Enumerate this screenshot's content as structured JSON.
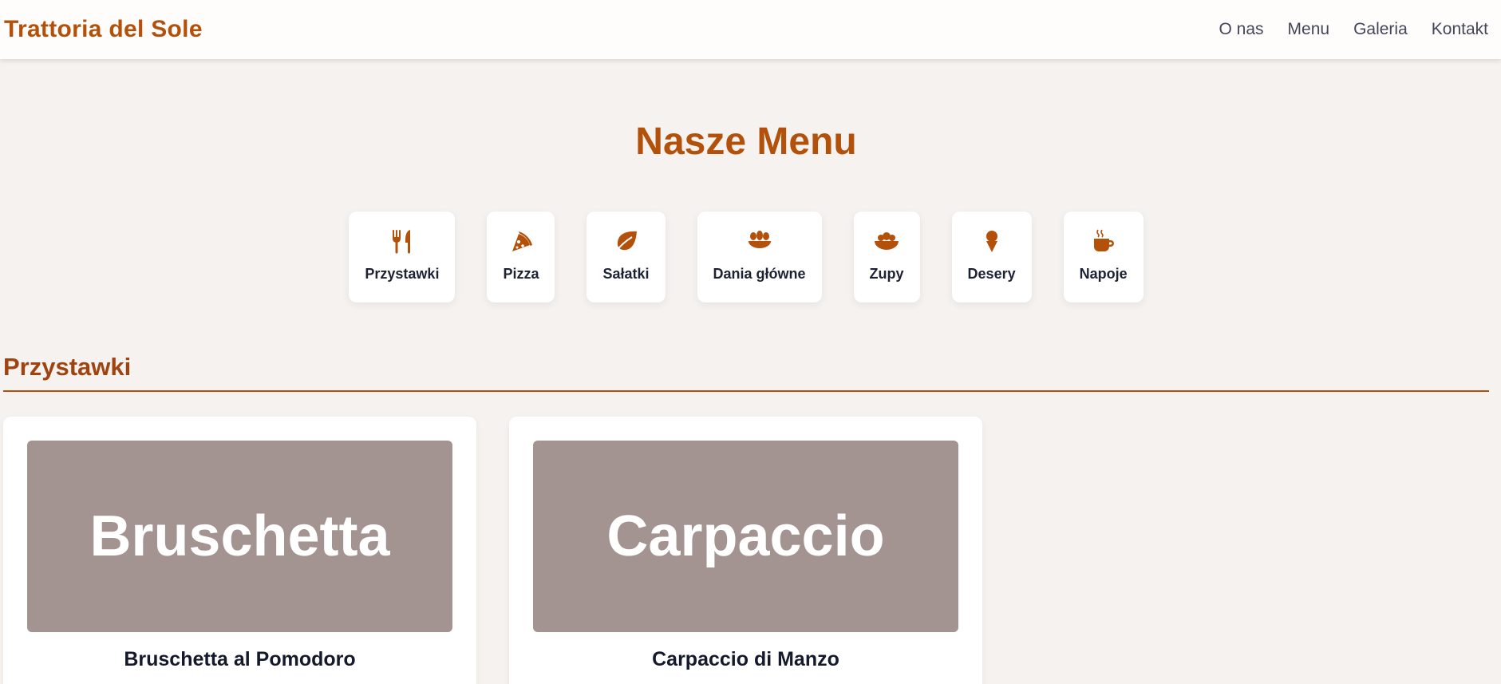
{
  "header": {
    "brand": "Trattoria del Sole",
    "nav": [
      "O nas",
      "Menu",
      "Galeria",
      "Kontakt"
    ]
  },
  "page_title": "Nasze Menu",
  "categories": [
    {
      "label": "Przystawki",
      "icon": "utensils-icon"
    },
    {
      "label": "Pizza",
      "icon": "pizza-slice-icon"
    },
    {
      "label": "Sałatki",
      "icon": "leaf-icon"
    },
    {
      "label": "Dania główne",
      "icon": "bread-icon"
    },
    {
      "label": "Zupy",
      "icon": "bowl-icon"
    },
    {
      "label": "Desery",
      "icon": "ice-cream-icon"
    },
    {
      "label": "Napoje",
      "icon": "coffee-cup-icon"
    }
  ],
  "section": {
    "title": "Przystawki",
    "items": [
      {
        "image_text": "Bruschetta",
        "name": "Bruschetta al Pomodoro"
      },
      {
        "image_text": "Carpaccio",
        "name": "Carpaccio di Manzo"
      }
    ]
  },
  "colors": {
    "accent": "#b3510b",
    "section_title": "#9f4410",
    "background": "#f6f2ef",
    "image_placeholder": "#a39391"
  }
}
